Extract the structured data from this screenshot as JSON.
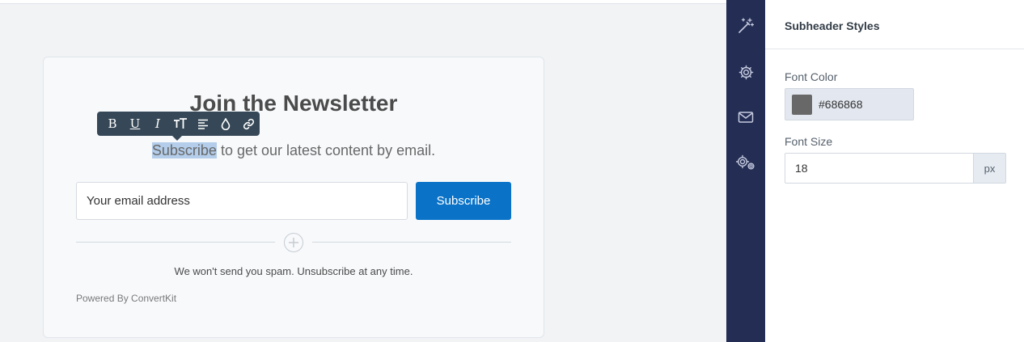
{
  "canvas": {
    "form": {
      "title": "Join the Newsletter",
      "subheader_selected": "Subscribe",
      "subheader_rest": " to get our latest content by email.",
      "email_placeholder": "Your email address",
      "button_label": "Subscribe",
      "disclaimer": "We won't send you spam. Unsubscribe at any time.",
      "powered_by": "Powered By ConvertKit"
    },
    "toolbar": {
      "bold_label": "B",
      "underline_label": "U",
      "italic_label": "I",
      "icons": [
        "bold-icon",
        "underline-icon",
        "italic-icon",
        "text-size-icon",
        "align-icon",
        "color-drop-icon",
        "link-icon"
      ]
    }
  },
  "iconbar": {
    "items": [
      "magic-wand-icon",
      "gear-icon",
      "envelope-icon",
      "advanced-settings-icon"
    ]
  },
  "panel": {
    "title": "Subheader Styles",
    "font_color_label": "Font Color",
    "font_color_value": "#686868",
    "font_size_label": "Font Size",
    "font_size_value": "18",
    "font_size_unit": "px"
  },
  "colors": {
    "accent": "#0a73c8",
    "sidebar": "#242d53",
    "swatch": "#686868",
    "toolbar": "#364857"
  }
}
